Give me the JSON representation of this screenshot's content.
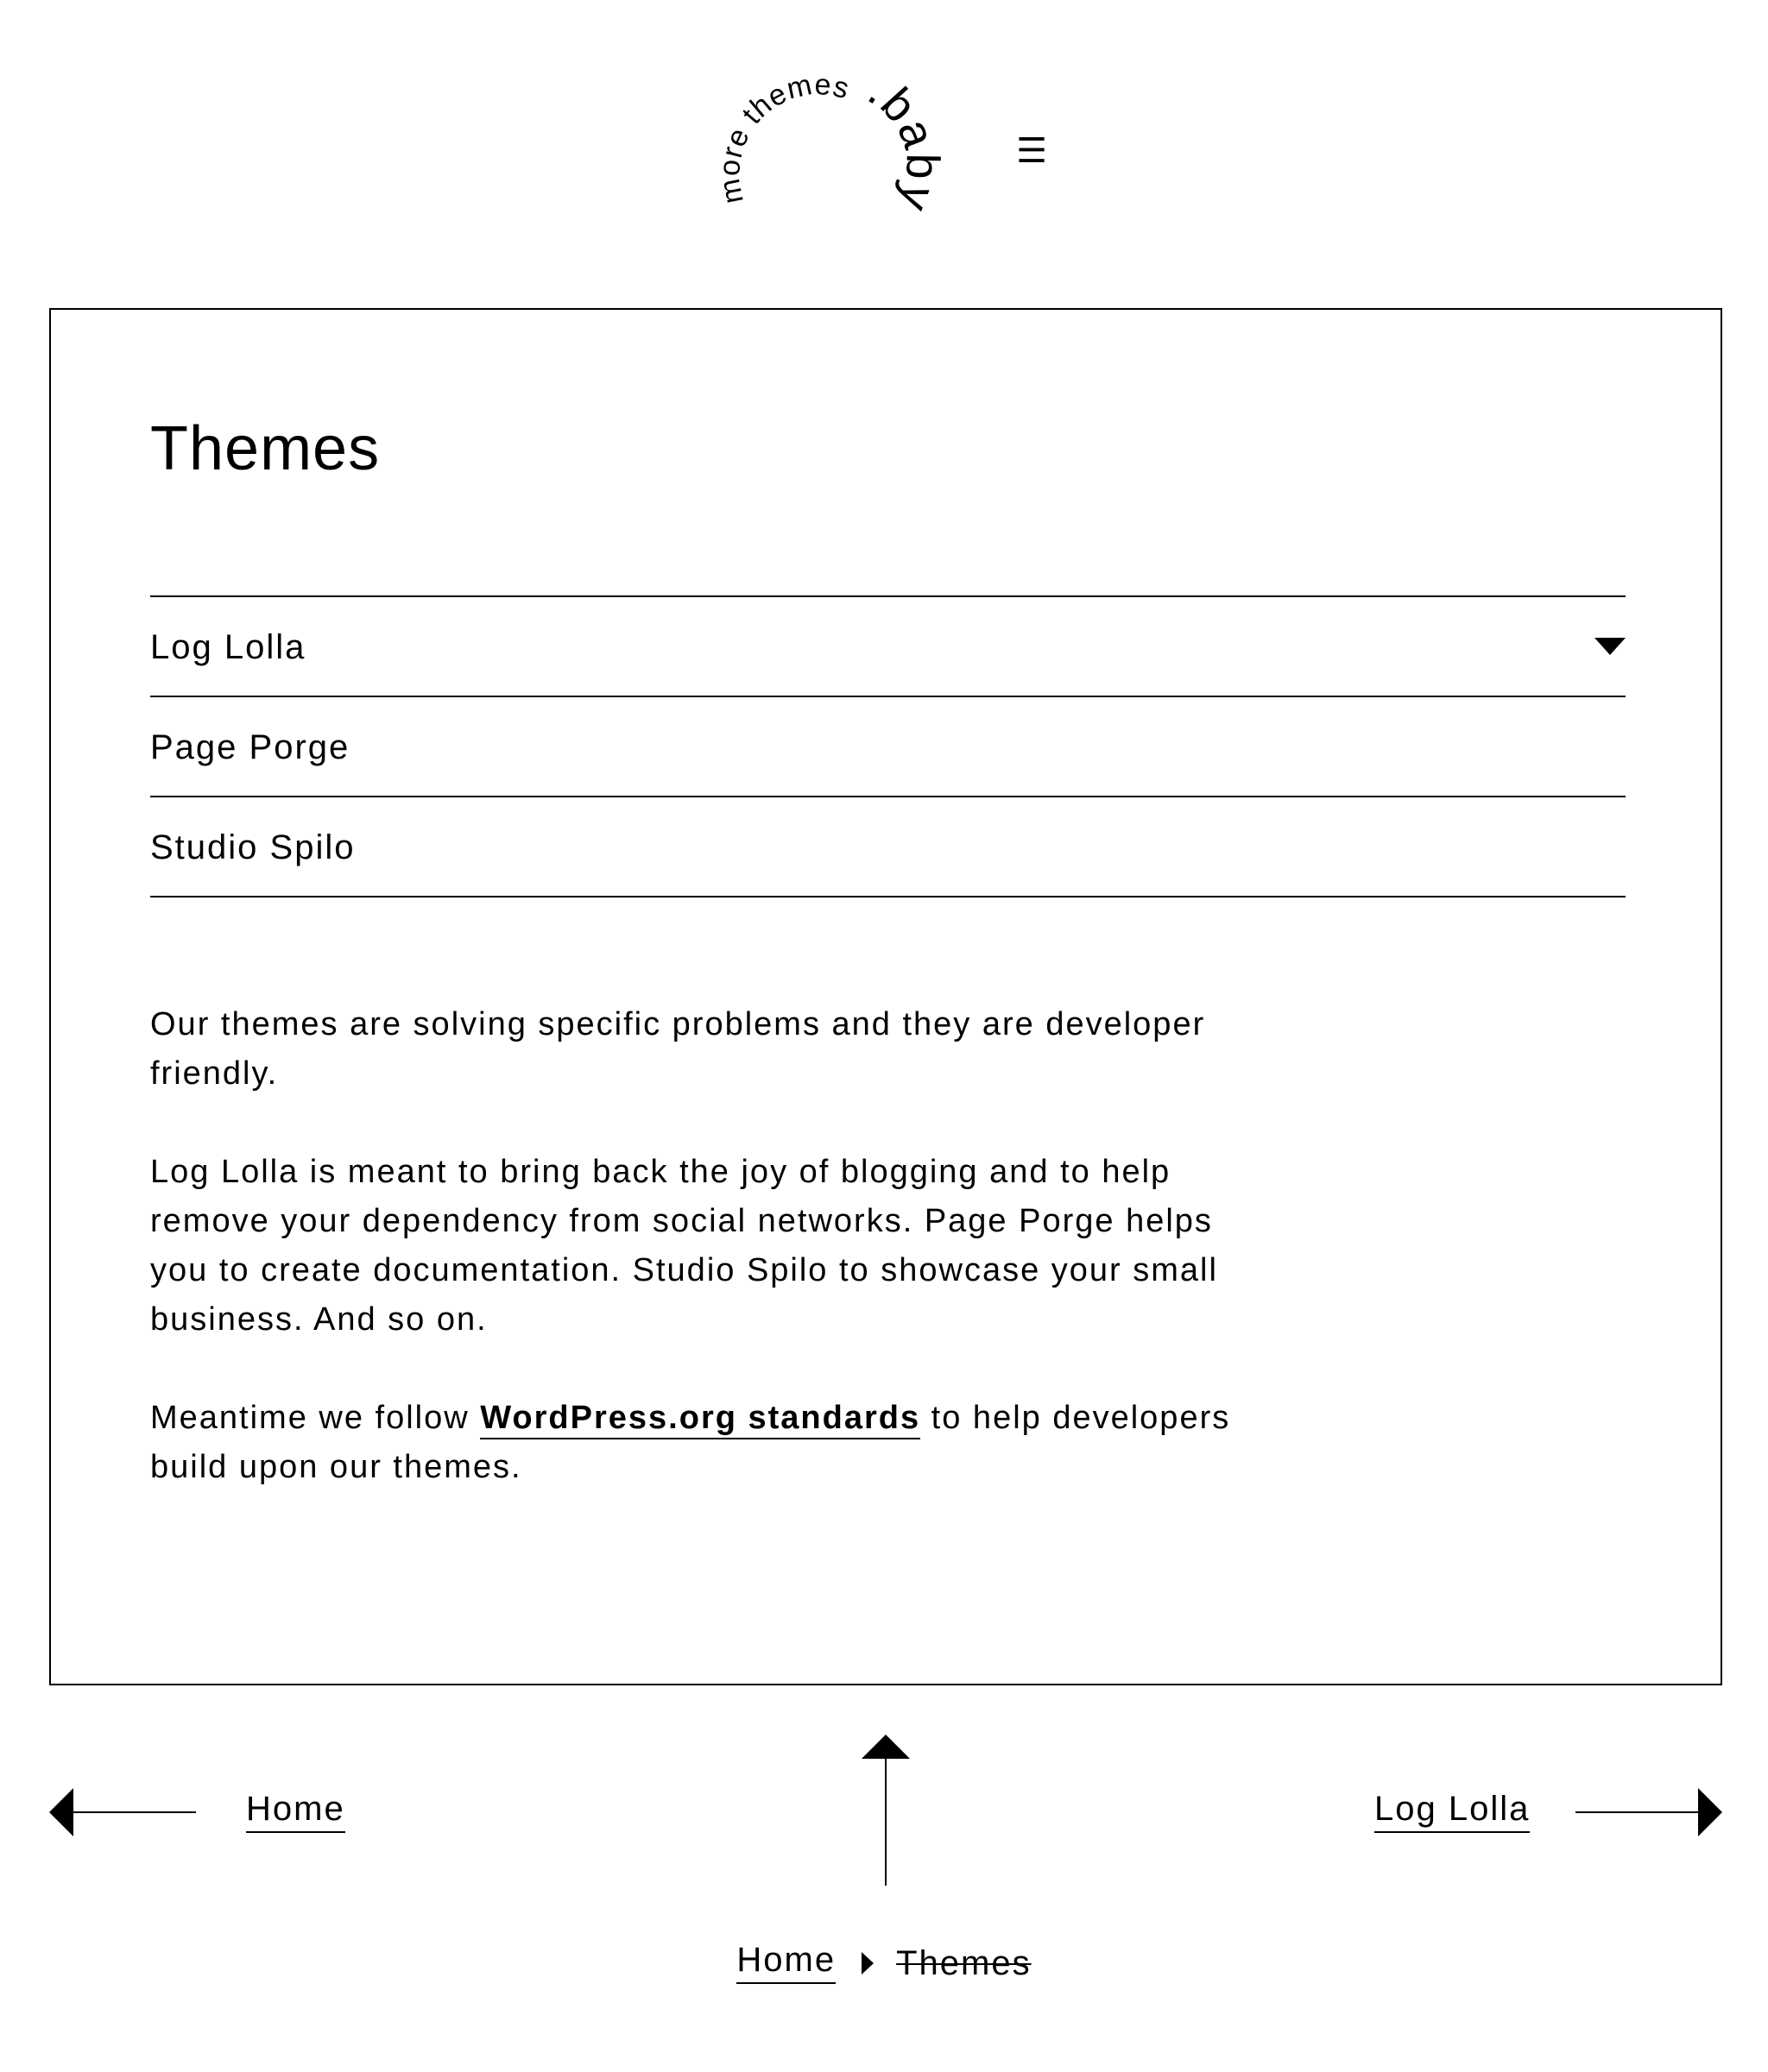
{
  "header": {
    "logo": {
      "small_text": "more themes",
      "big_text": ".baby"
    },
    "menu_icon": "☰"
  },
  "main": {
    "title": "Themes",
    "accordion": [
      {
        "label": "Log Lolla",
        "expanded_indicator": "caret-down"
      },
      {
        "label": "Page Porge"
      },
      {
        "label": "Studio Spilo"
      }
    ],
    "paragraphs": {
      "p1": "Our themes are solving specific problems and they are developer friendly.",
      "p2": "Log Lolla is meant to bring back the joy of blogging and to help remove your dependency from social networks. Page Porge helps you to create documentation. Studio Spilo to showcase your small business. And so on.",
      "p3_before": "Meantime we follow ",
      "p3_link": "WordPress.org standards",
      "p3_after": " to help developers build upon our themes."
    }
  },
  "post_nav": {
    "prev_label": "Home",
    "next_label": "Log Lolla"
  },
  "breadcrumb": {
    "home": "Home",
    "current": "Themes"
  }
}
